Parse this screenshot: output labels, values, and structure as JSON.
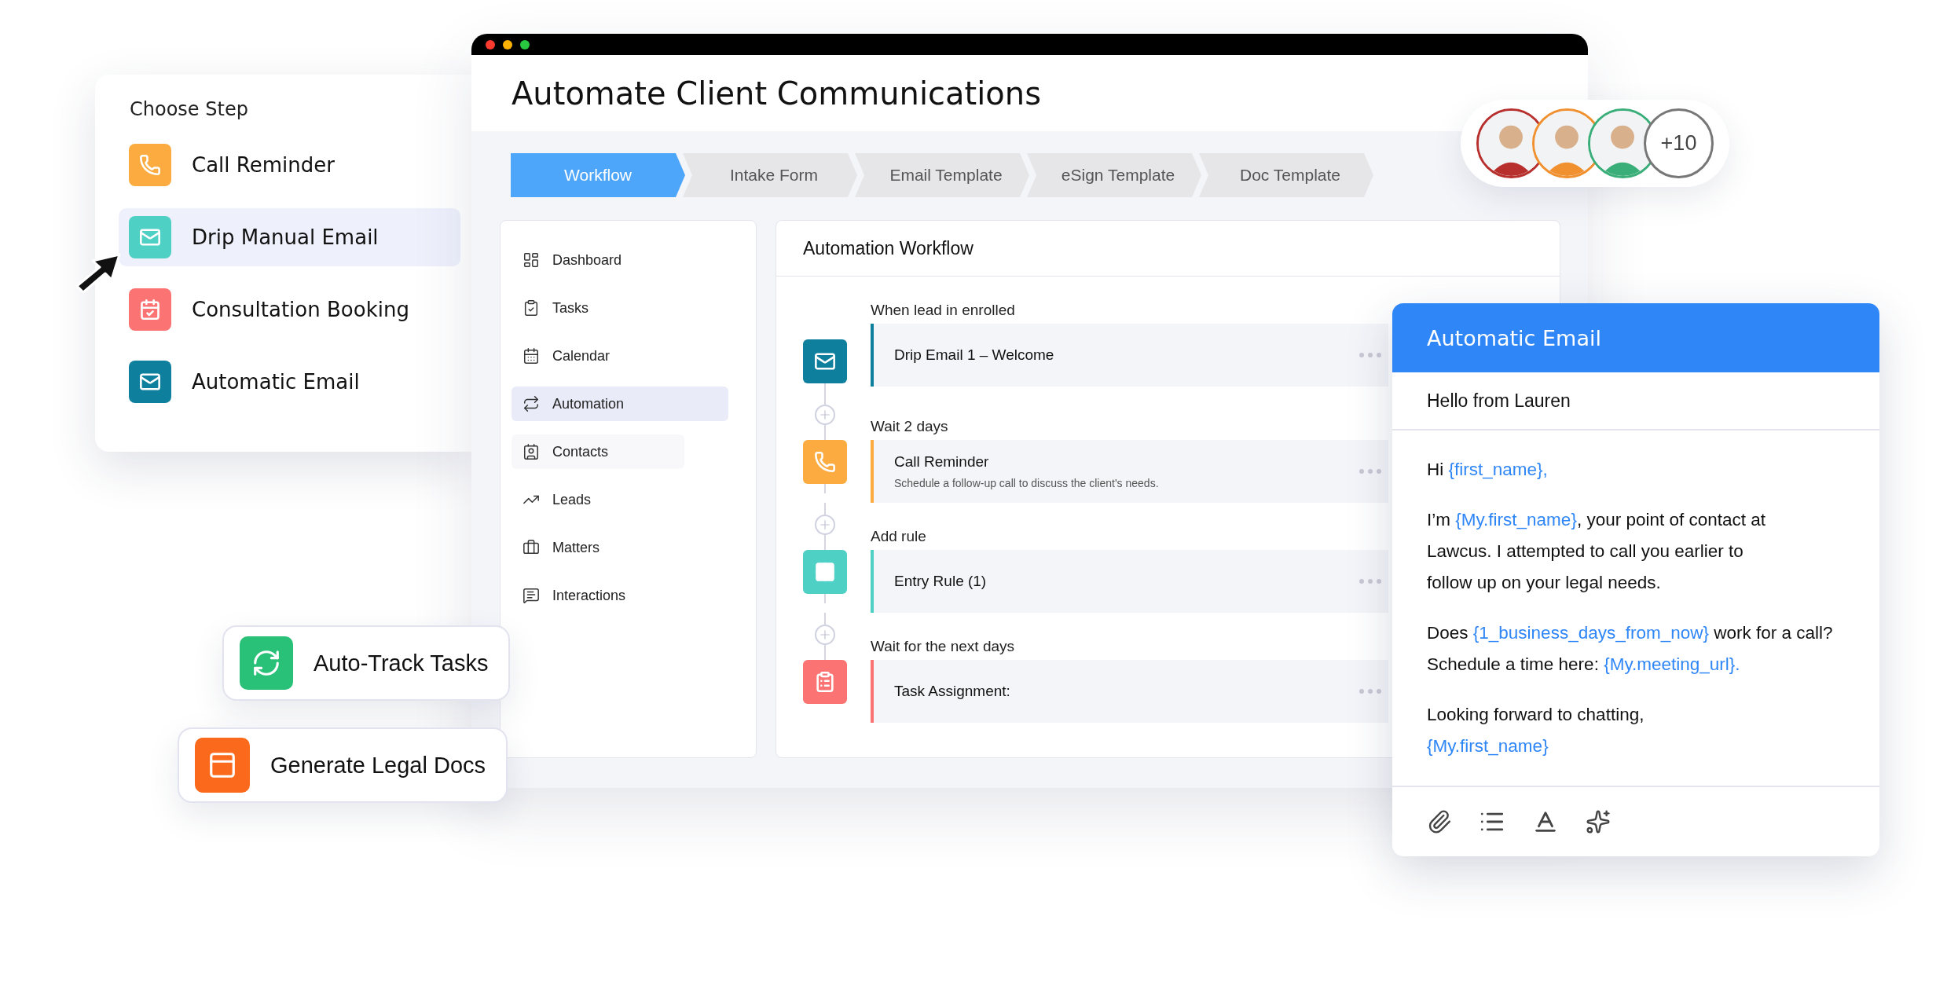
{
  "steps_card": {
    "title": "Choose Step",
    "items": [
      {
        "label": "Call Reminder",
        "color": "#fbab3f",
        "selected": false
      },
      {
        "label": "Drip Manual Email",
        "color": "#4fd0c4",
        "selected": true
      },
      {
        "label": "Consultation Booking",
        "color": "#fb7373",
        "selected": false
      },
      {
        "label": "Automatic Email",
        "color": "#0f7f9e",
        "selected": false
      }
    ]
  },
  "features": [
    {
      "label": "Auto-Track Tasks",
      "color": "#29c178"
    },
    {
      "label": "Generate Legal Docs",
      "color": "#fb6a1c"
    }
  ],
  "window": {
    "title": "Automate Client Communications",
    "tabs": [
      {
        "label": "Workflow",
        "selected": true
      },
      {
        "label": "Intake Form",
        "selected": false
      },
      {
        "label": "Email Template",
        "selected": false
      },
      {
        "label": "eSign Template",
        "selected": false
      },
      {
        "label": "Doc Template",
        "selected": false
      }
    ],
    "sidebar": {
      "items": [
        {
          "label": "Dashboard",
          "selected": false,
          "hovered": false
        },
        {
          "label": "Tasks",
          "selected": false,
          "hovered": false
        },
        {
          "label": "Calendar",
          "selected": false,
          "hovered": false
        },
        {
          "label": "Automation",
          "selected": true,
          "hovered": false
        },
        {
          "label": "Contacts",
          "selected": false,
          "hovered": true
        },
        {
          "label": "Leads",
          "selected": false,
          "hovered": false
        },
        {
          "label": "Matters",
          "selected": false,
          "hovered": false
        },
        {
          "label": "Interactions",
          "selected": false,
          "hovered": false
        }
      ]
    },
    "workflow": {
      "title": "Automation Workflow",
      "steps": [
        {
          "label": "When lead in enrolled",
          "title": "Drip Email 1 – Welcome",
          "color": "#0f7f9e"
        },
        {
          "label": "Wait 2 days",
          "title": "Call Reminder",
          "description": "Schedule a follow-up call to discuss the client's needs.",
          "color": "#fbab3f"
        },
        {
          "label": "Add rule",
          "title": "Entry Rule (1)",
          "color": "#4fd0c4"
        },
        {
          "label": "Wait for the next days",
          "title": "Task Assignment:",
          "color": "#fb7373"
        }
      ]
    }
  },
  "avatars": [
    {
      "color": "#b8302e"
    },
    {
      "color": "#f0902f"
    },
    {
      "color": "#3aae78"
    }
  ],
  "avatars_more": "+10",
  "email": {
    "title": "Automatic Email",
    "subject": "Hello from Lauren",
    "paragraphs": [
      {
        "lines": [
          [
            {
              "kind": "text",
              "text": "Hi "
            },
            {
              "kind": "variable",
              "text": "{first_name},"
            }
          ]
        ]
      },
      {
        "lines": [
          [
            {
              "kind": "text",
              "text": "I’m "
            },
            {
              "kind": "variable",
              "text": "{My.first_name}"
            },
            {
              "kind": "text",
              "text": ", your point of contact at"
            }
          ],
          [
            {
              "kind": "text",
              "text": "Lawcus. I attempted to call you earlier to"
            }
          ],
          [
            {
              "kind": "text",
              "text": "follow up on your legal needs."
            }
          ]
        ]
      },
      {
        "lines": [
          [
            {
              "kind": "text",
              "text": "Does "
            },
            {
              "kind": "variable",
              "text": "{1_business_days_from_now}"
            },
            {
              "kind": "text",
              "text": " work for a call?"
            }
          ],
          [
            {
              "kind": "text",
              "text": "Schedule a time here: "
            },
            {
              "kind": "variable",
              "text": "{My.meeting_url}."
            }
          ]
        ]
      },
      {
        "lines": [
          [
            {
              "kind": "text",
              "text": "Looking forward to chatting,"
            }
          ],
          [
            {
              "kind": "variable",
              "text": "{My.first_name}"
            }
          ]
        ]
      }
    ]
  }
}
